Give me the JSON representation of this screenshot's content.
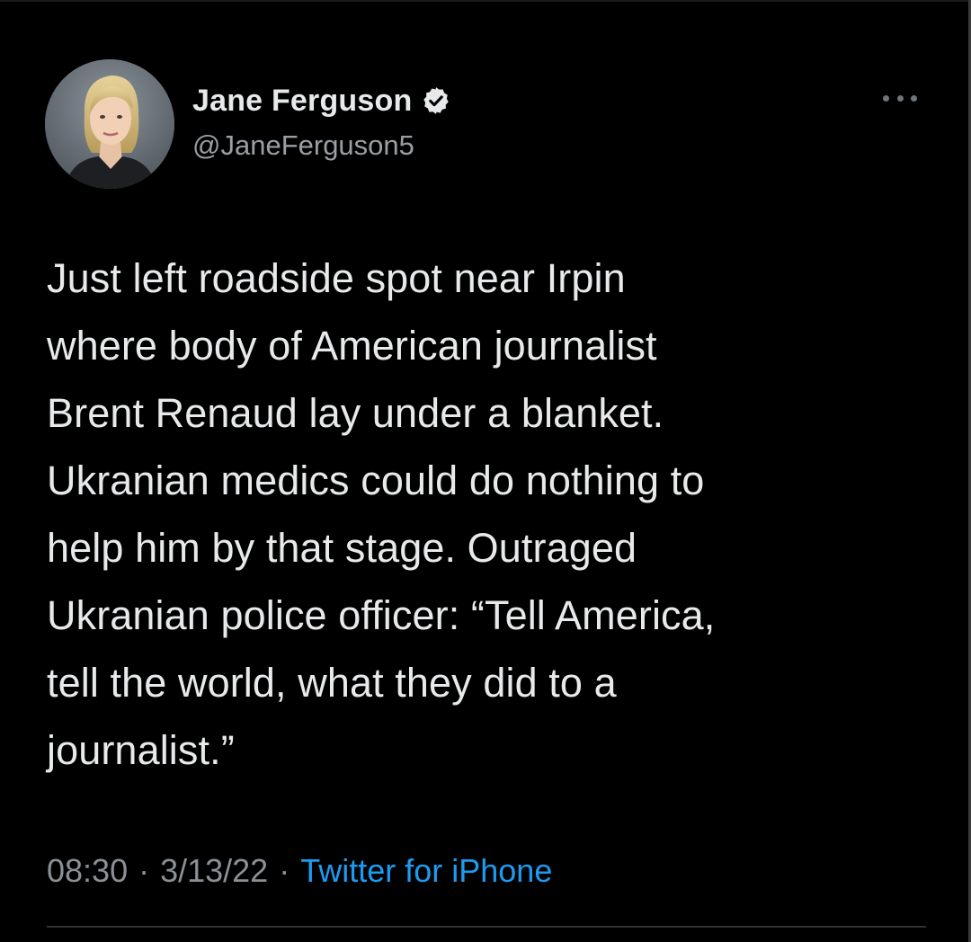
{
  "author": {
    "display_name": "Jane Ferguson",
    "handle": "@JaneFerguson5",
    "verified": true
  },
  "icons": {
    "verified": "verified-badge-icon",
    "more": "more-options-icon"
  },
  "tweet": {
    "text": "Just left roadside spot near Irpin\nwhere body of American journalist\nBrent Renaud lay under a blanket.\nUkranian medics could do nothing to\nhelp him by that stage. Outraged\nUkranian police officer: “Tell America,\ntell the world, what they did to a\njournalist.”"
  },
  "meta": {
    "time": "08:30",
    "separator": "·",
    "date": "3/13/22",
    "source": "Twitter for iPhone"
  },
  "colors": {
    "background": "#000000",
    "text": "#e7e9ea",
    "secondary": "#8b9096",
    "link": "#1d9bf0"
  }
}
